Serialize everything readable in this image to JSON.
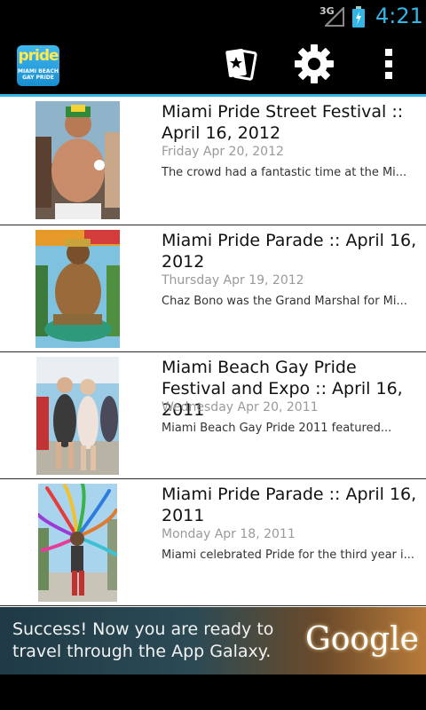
{
  "status": {
    "network": "3G",
    "time": "4:21"
  },
  "actionbar": {
    "logo_word": "pride",
    "logo_sub": "MIAMI BEACH GAY PRIDE",
    "icons": [
      "cards-icon",
      "gear-icon",
      "overflow-menu-icon"
    ]
  },
  "feed": [
    {
      "title": "Miami Pride Street Festival :: April 16, 2012",
      "date": "Friday Apr 20, 2012",
      "snippet": "The crowd had a fantastic time at the Mi..."
    },
    {
      "title": "Miami Pride Parade :: April 16, 2012",
      "date": "Thursday Apr 19, 2012",
      "snippet": "Chaz Bono was the Grand Marshal for Mi..."
    },
    {
      "title": "Miami Beach Gay Pride Festival and Expo :: April 16, 2011",
      "date": "Wednesday Apr 20, 2011",
      "snippet": "Miami Beach Gay Pride 2011 featured..."
    },
    {
      "title": "Miami Pride Parade :: April 16, 2011",
      "date": "Monday Apr 18, 2011",
      "snippet": "Miami celebrated Pride for the third year i..."
    }
  ],
  "ad": {
    "text": "Success! Now you are ready to travel through the App Galaxy.",
    "brand": "Google"
  },
  "colors": {
    "accent": "#33b5e5",
    "list_bg": "#ffffff",
    "date": "#9a9a9a"
  }
}
